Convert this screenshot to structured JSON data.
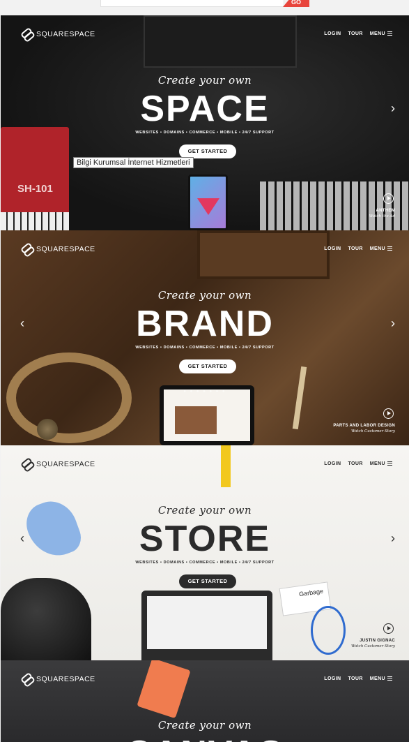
{
  "topbar": {
    "go_label": "GO"
  },
  "tooltip": "Bilgi Kurumsal İnternet Hizmetleri",
  "slides": [
    {
      "logo": "SQUARESPACE",
      "nav": [
        "LOGIN",
        "TOUR",
        "MENU"
      ],
      "create": "Create your own",
      "word": "SPACE",
      "tagline": "WEBSITES • DOMAINS • COMMERCE • MOBILE • 24/7 SUPPORT",
      "cta": "GET STARTED",
      "play_title": "ANTHEM",
      "play_sub": "Watch the Ad"
    },
    {
      "logo": "SQUARESPACE",
      "nav": [
        "LOGIN",
        "TOUR",
        "MENU"
      ],
      "create": "Create your own",
      "word": "BRAND",
      "tagline": "WEBSITES • DOMAINS • COMMERCE • MOBILE • 24/7 SUPPORT",
      "cta": "GET STARTED",
      "play_title": "PARTS AND LABOR DESIGN",
      "play_sub": "Watch Customer Story"
    },
    {
      "logo": "SQUARESPACE",
      "nav": [
        "LOGIN",
        "TOUR",
        "MENU"
      ],
      "create": "Create your own",
      "word": "STORE",
      "tagline": "WEBSITES • DOMAINS • COMMERCE • MOBILE • 24/7 SUPPORT",
      "cta": "GET STARTED",
      "play_title": "JUSTIN GIGNAC",
      "play_sub": "Watch Customer Story"
    },
    {
      "logo": "SQUARESPACE",
      "nav": [
        "LOGIN",
        "TOUR",
        "MENU"
      ],
      "create": "Create your own",
      "word": "CANVAS"
    }
  ],
  "decor": {
    "synth_label": "SH-101",
    "garbage_label": "Garbage"
  }
}
